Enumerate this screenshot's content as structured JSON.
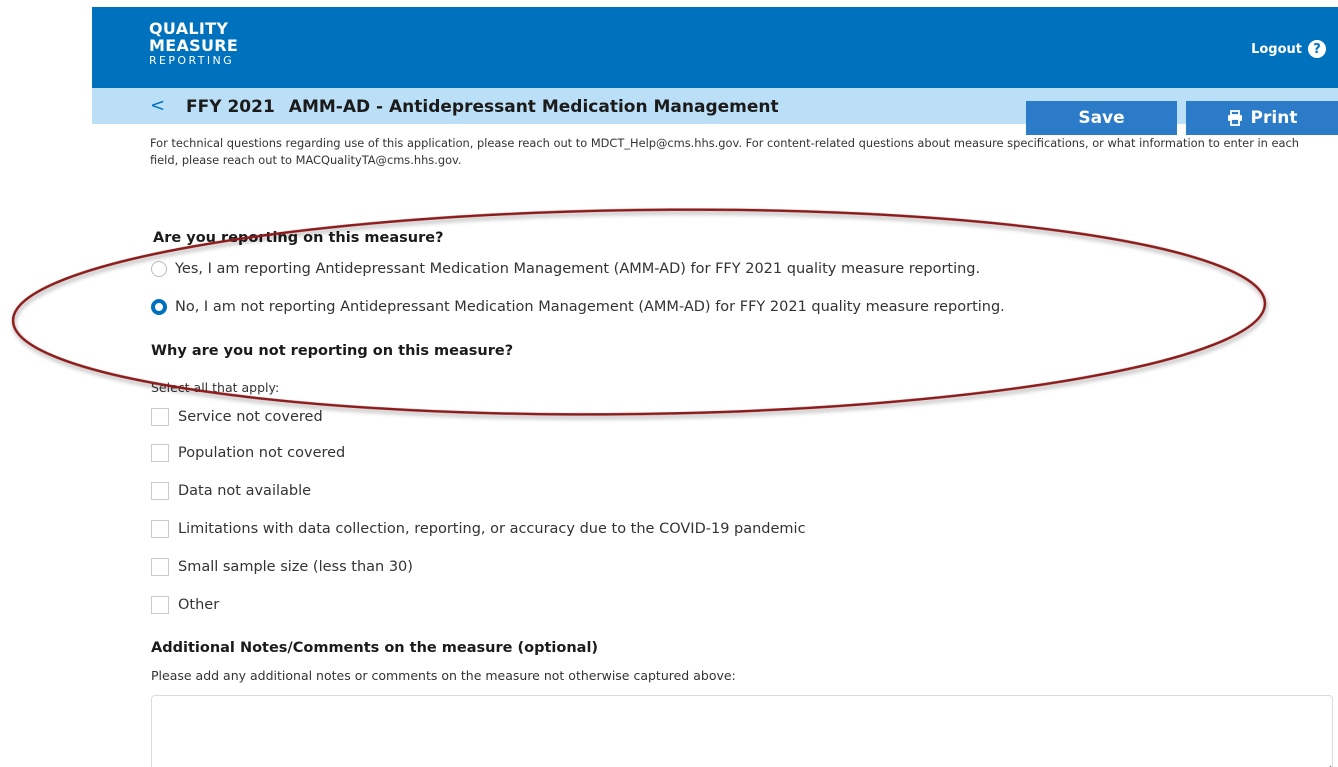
{
  "header": {
    "logo": {
      "line1": "QUALITY",
      "line2": "MEASURE",
      "line3": "REPORTING"
    },
    "logout_label": "Logout",
    "help_glyph": "?"
  },
  "subheader": {
    "back_glyph": "<",
    "ffy": "FFY 2021",
    "measure_title": "AMM-AD - Antidepressant Medication Management",
    "save_label": "Save",
    "print_label": "Print"
  },
  "intro_text": "For technical questions regarding use of this application, please reach out to MDCT_Help@cms.hhs.gov. For content-related questions about measure specifications, or what information to enter in each field, please reach out to MACQualityTA@cms.hhs.gov.",
  "reporting": {
    "question": "Are you reporting on this measure?",
    "options": [
      {
        "label": "Yes, I am reporting Antidepressant Medication Management (AMM-AD) for FFY 2021 quality measure reporting.",
        "selected": false
      },
      {
        "label": "No, I am not reporting Antidepressant Medication Management (AMM-AD) for FFY 2021 quality measure reporting.",
        "selected": true
      }
    ]
  },
  "why_not": {
    "question": "Why are you not reporting on this measure?",
    "instruction": "Select all that apply:",
    "options": [
      {
        "label": "Service not covered",
        "checked": false
      },
      {
        "label": "Population not covered",
        "checked": false
      },
      {
        "label": "Data not available",
        "checked": false
      },
      {
        "label": "Limitations with data collection, reporting, or accuracy due to the COVID-19 pandemic",
        "checked": false
      },
      {
        "label": "Small sample size (less than 30)",
        "checked": false
      },
      {
        "label": "Other",
        "checked": false
      }
    ]
  },
  "notes": {
    "heading": "Additional Notes/Comments on the measure (optional)",
    "help_text": "Please add any additional notes or comments on the measure not otherwise captured above:",
    "value": ""
  },
  "colors": {
    "brand_blue": "#0071bc",
    "subbar_blue": "#bbdff7",
    "button_blue": "#2b7bc8",
    "annotation_red": "#8b1a1a"
  },
  "icons": [
    "help-icon",
    "back-chevron-icon",
    "print-icon",
    "resize-handle-icon"
  ]
}
